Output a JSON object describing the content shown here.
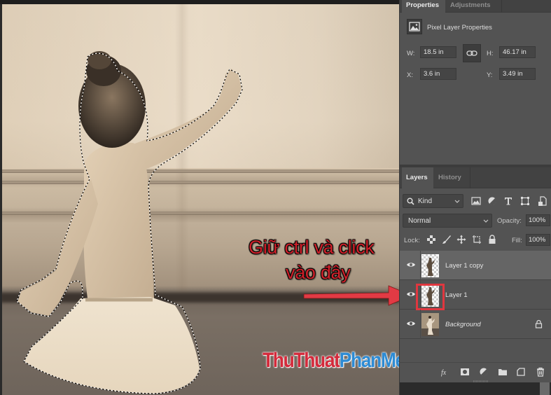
{
  "properties_panel": {
    "tabs": [
      {
        "label": "Properties",
        "active": true
      },
      {
        "label": "Adjustments",
        "active": false
      }
    ],
    "section_title": "Pixel Layer Properties",
    "fields": {
      "w_label": "W:",
      "w_value": "18.5 in",
      "h_label": "H:",
      "h_value": "46.17 in",
      "x_label": "X:",
      "x_value": "3.6 in",
      "y_label": "Y:",
      "y_value": "3.49 in"
    },
    "link_icon": "link-chain-icon"
  },
  "layers_panel": {
    "tabs": [
      {
        "label": "Layers",
        "active": true
      },
      {
        "label": "History",
        "active": false
      }
    ],
    "filter": {
      "kind_label": "Kind",
      "icons": [
        "pixel-filter-icon",
        "adjustment-filter-icon",
        "type-filter-icon",
        "shape-filter-icon",
        "smart-object-filter-icon"
      ]
    },
    "blend_mode": "Normal",
    "opacity_label": "Opacity:",
    "opacity_value": "100%",
    "lock_label": "Lock:",
    "lock_icons": [
      "lock-transparent-pixels-icon",
      "lock-image-pixels-icon",
      "lock-position-icon",
      "lock-artboard-icon",
      "lock-all-icon"
    ],
    "fill_label": "Fill:",
    "fill_value": "100%",
    "layers": [
      {
        "name": "Layer 1 copy",
        "visible": true,
        "selected": true,
        "italic": false,
        "locked": false
      },
      {
        "name": "Layer 1",
        "visible": true,
        "selected": false,
        "italic": false,
        "locked": false,
        "highlighted": true
      },
      {
        "name": "Background",
        "visible": true,
        "selected": false,
        "italic": true,
        "locked": true
      }
    ],
    "footer_icons": [
      "add-layer-style-icon",
      "add-mask-icon",
      "new-adjustment-layer-icon",
      "new-group-icon",
      "new-layer-icon",
      "delete-layer-icon"
    ]
  },
  "annotation": {
    "line1": "Giữ ctrl và click",
    "line2": "vào đây",
    "color": "#d0202a"
  },
  "watermark": {
    "part1": "ThuThuat",
    "part2": "PhanMem.vn",
    "color1": "#d42a3b",
    "color2": "#2d8bd4"
  },
  "canvas": {
    "description": "Sepia photo of a young ballerina with marching-ants selection around her"
  }
}
